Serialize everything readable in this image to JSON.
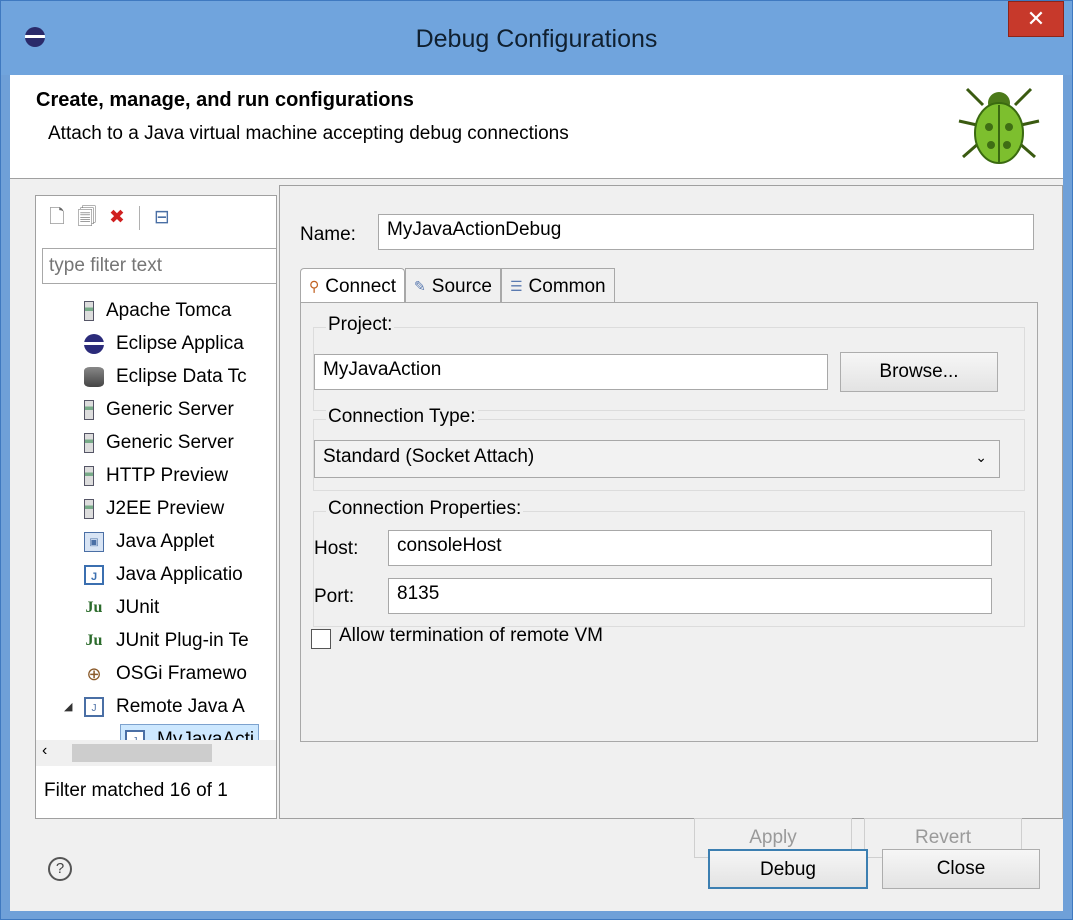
{
  "window": {
    "title": "Debug Configurations",
    "close_glyph": "✕"
  },
  "header": {
    "title": "Create, manage, and run configurations",
    "description": "Attach to a Java virtual machine accepting debug connections",
    "icon": "bug-icon"
  },
  "left": {
    "toolbar": [
      {
        "name": "new-launch-configuration-icon",
        "glyph": "🗋"
      },
      {
        "name": "duplicate-icon",
        "glyph": "🗐"
      },
      {
        "name": "delete-icon",
        "glyph": "✖"
      },
      {
        "name": "collapse-all-icon",
        "glyph": "⊟"
      }
    ],
    "filter_placeholder": "type filter text",
    "tree": [
      {
        "label": "Apache Tomca",
        "icon": "server-icon"
      },
      {
        "label": "Eclipse Applica",
        "icon": "eclipse-icon"
      },
      {
        "label": "Eclipse Data Tc",
        "icon": "database-icon"
      },
      {
        "label": "Generic Server",
        "icon": "server-icon"
      },
      {
        "label": "Generic Server",
        "icon": "server-icon"
      },
      {
        "label": "HTTP Preview",
        "icon": "server-icon"
      },
      {
        "label": "J2EE Preview",
        "icon": "server-icon"
      },
      {
        "label": "Java Applet",
        "icon": "java-applet-icon"
      },
      {
        "label": "Java Applicatio",
        "icon": "java-application-icon"
      },
      {
        "label": "JUnit",
        "icon": "junit-icon"
      },
      {
        "label": "JUnit Plug-in Te",
        "icon": "junit-plugin-icon"
      },
      {
        "label": "OSGi Framewo",
        "icon": "osgi-icon"
      },
      {
        "label": "Remote Java A",
        "icon": "remote-java-icon",
        "expanded": true
      },
      {
        "label": "MyJavaActi",
        "icon": "remote-java-icon",
        "selected": true
      }
    ],
    "filter_status": "Filter matched 16 of 1"
  },
  "form": {
    "name_label": "Name:",
    "name_value": "MyJavaActionDebug",
    "tabs": [
      {
        "label": "Connect",
        "active": true
      },
      {
        "label": "Source"
      },
      {
        "label": "Common"
      }
    ],
    "project_label": "Project:",
    "project_value": "MyJavaAction",
    "browse_label": "Browse...",
    "connection_type_label": "Connection Type:",
    "connection_type_value": "Standard (Socket Attach)",
    "connection_props_label": "Connection Properties:",
    "host_label": "Host:",
    "host_value": "consoleHost",
    "port_label": "Port:",
    "port_value": "8135",
    "allow_termination_label": "Allow termination of remote VM",
    "allow_termination_checked": false,
    "apply_label": "Apply",
    "revert_label": "Revert"
  },
  "footer": {
    "help_glyph": "?",
    "debug_label": "Debug",
    "close_label": "Close"
  },
  "colors": {
    "titlebar": "#70a4dd",
    "close_button": "#c7392b",
    "selection": "#cde8ff",
    "default_button_border": "#3c7fb1"
  }
}
